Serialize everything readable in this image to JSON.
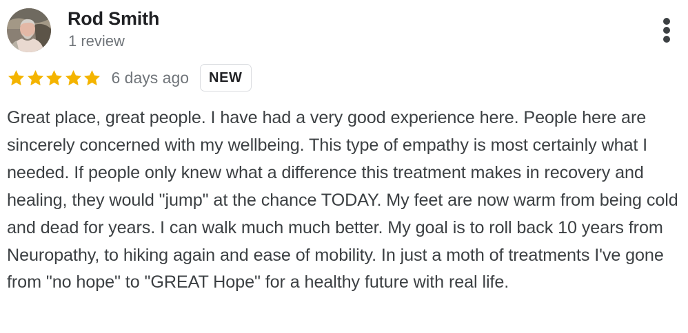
{
  "review": {
    "author_name": "Rod Smith",
    "review_count": "1 review",
    "rating": 5,
    "rating_max": 5,
    "date": "6 days ago",
    "badge": "NEW",
    "text": "Great place, great people. I have had a very good experience here. People here are sincerely concerned with my wellbeing. This type of empathy is most certainly what I needed. If people only knew what a difference this treatment makes in recovery and healing, they would \"jump\" at the chance TODAY. My feet are now warm from being cold and dead for years. I can walk much much better. My goal is to roll back 10 years from Neuropathy, to hiking again and ease of mobility. In just a moth of treatments I've gone from \"no hope\" to \"GREAT Hope\" for a healthy future with real life."
  },
  "icons": {
    "star": "star-icon",
    "more": "more-vert-icon"
  },
  "colors": {
    "star": "#f4b400",
    "name": "#202124",
    "secondary_text": "#70757a",
    "body_text": "#3c4043",
    "badge_border": "#dadce0"
  }
}
